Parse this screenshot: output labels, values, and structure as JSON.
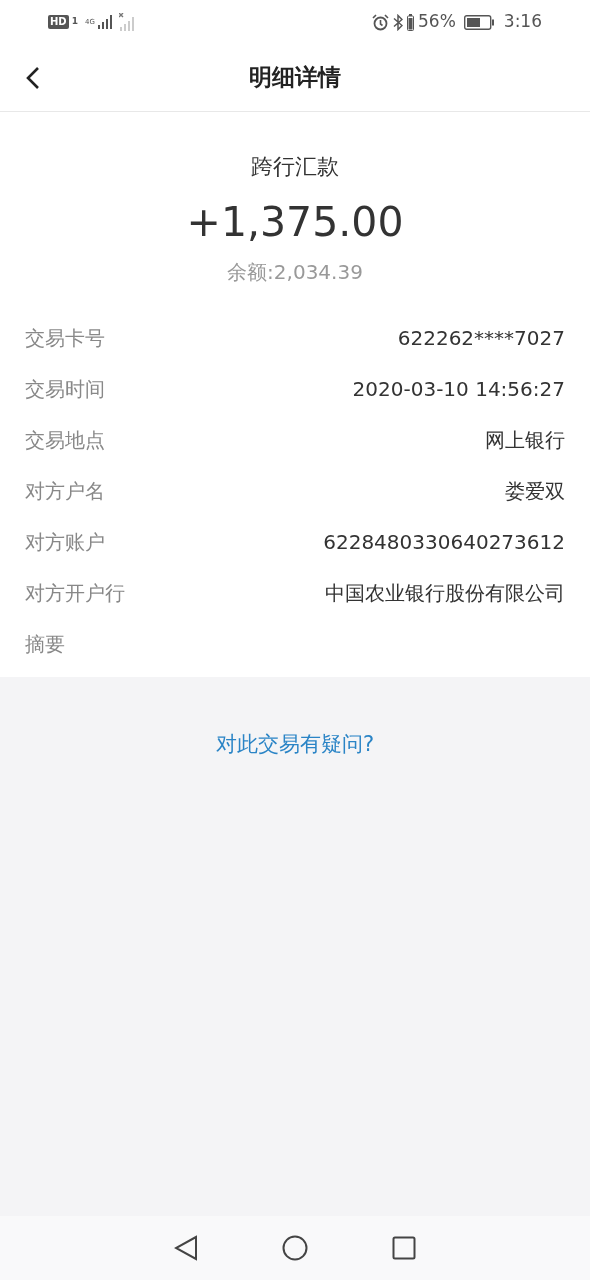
{
  "status_bar": {
    "hd": "HD",
    "sim": "1",
    "network": "4G",
    "battery_percent": "56%",
    "time": "3:16"
  },
  "header": {
    "title": "明细详情"
  },
  "summary": {
    "type": "跨行汇款",
    "amount": "+1,375.00",
    "balance": "余额:2,034.39"
  },
  "details": [
    {
      "label": "交易卡号",
      "value": "622262****7027"
    },
    {
      "label": "交易时间",
      "value": "2020-03-10 14:56:27"
    },
    {
      "label": "交易地点",
      "value": "网上银行"
    },
    {
      "label": "对方户名",
      "value": "娄爱双"
    },
    {
      "label": "对方账户",
      "value": "6228480330640273612"
    },
    {
      "label": "对方开户行",
      "value": "中国农业银行股份有限公司"
    },
    {
      "label": "摘要"
    }
  ],
  "help_link": "对此交易有疑问?"
}
